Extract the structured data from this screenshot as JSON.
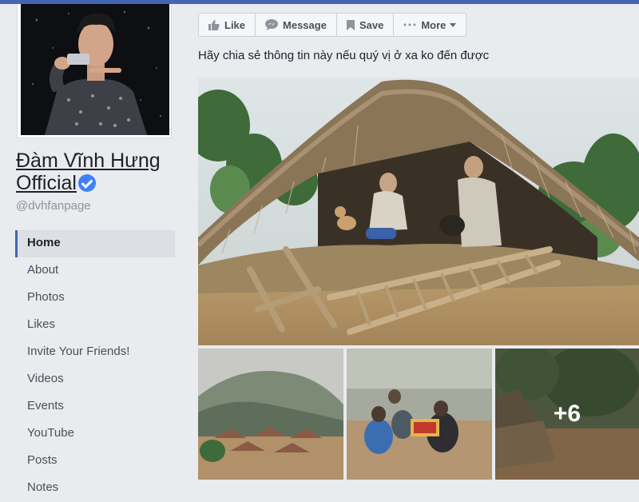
{
  "page": {
    "name": "Đàm Vĩnh Hưng Official",
    "handle": "@dvhfanpage"
  },
  "nav": {
    "items": [
      {
        "label": "Home",
        "active": true
      },
      {
        "label": "About"
      },
      {
        "label": "Photos"
      },
      {
        "label": "Likes"
      },
      {
        "label": "Invite Your Friends!"
      },
      {
        "label": "Videos"
      },
      {
        "label": "Events"
      },
      {
        "label": "YouTube"
      },
      {
        "label": "Posts"
      },
      {
        "label": "Notes"
      }
    ]
  },
  "toolbar": {
    "like": "Like",
    "message": "Message",
    "save": "Save",
    "more": "More"
  },
  "post": {
    "text": "Hãy chia sẻ thông tin này nếu quý vị ở xa ko đến được",
    "more_photos": "+6"
  },
  "colors": {
    "facebook_blue": "#4267b2",
    "verified_badge": "#4080ff",
    "background": "#e9ebee"
  },
  "icons": [
    "thumbs-up-icon",
    "message-bubble-icon",
    "bookmark-icon",
    "ellipsis-icon",
    "verified-badge-icon",
    "chevron-down-icon"
  ]
}
